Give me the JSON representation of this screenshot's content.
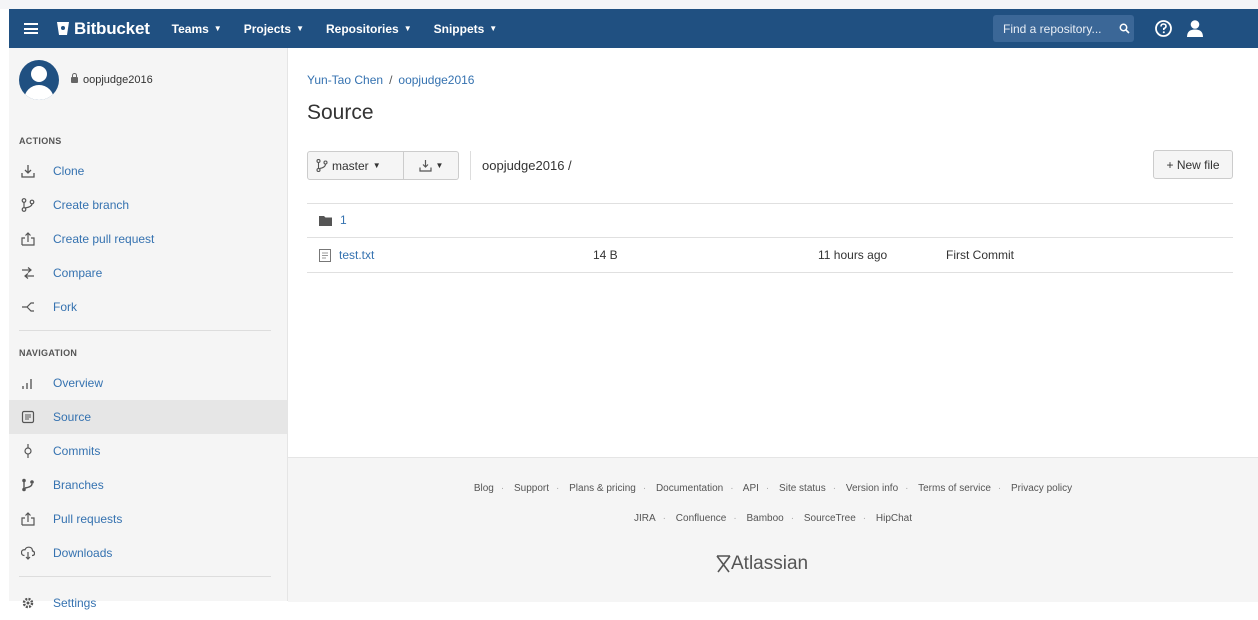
{
  "header": {
    "brand": "Bitbucket",
    "nav": [
      {
        "label": "Teams"
      },
      {
        "label": "Projects"
      },
      {
        "label": "Repositories"
      },
      {
        "label": "Snippets"
      }
    ],
    "search_placeholder": "Find a repository...",
    "icons": [
      "menu-icon",
      "bitbucket-logo-icon",
      "search-icon",
      "help-icon",
      "user-icon"
    ],
    "bg_color": "#205081"
  },
  "sidebar": {
    "repo_name": "oopjudge2016",
    "actions_title": "ACTIONS",
    "actions": [
      {
        "label": "Clone",
        "icon": "clone-icon"
      },
      {
        "label": "Create branch",
        "icon": "branch-icon"
      },
      {
        "label": "Create pull request",
        "icon": "pull-request-icon"
      },
      {
        "label": "Compare",
        "icon": "compare-icon"
      },
      {
        "label": "Fork",
        "icon": "fork-icon"
      }
    ],
    "navigation_title": "NAVIGATION",
    "navigation": [
      {
        "label": "Overview",
        "icon": "overview-icon"
      },
      {
        "label": "Source",
        "icon": "source-icon",
        "active": true
      },
      {
        "label": "Commits",
        "icon": "commits-icon"
      },
      {
        "label": "Branches",
        "icon": "branches-icon"
      },
      {
        "label": "Pull requests",
        "icon": "pull-requests-icon"
      },
      {
        "label": "Downloads",
        "icon": "downloads-icon"
      },
      {
        "label": "Settings",
        "icon": "settings-icon"
      }
    ]
  },
  "main": {
    "breadcrumb": {
      "owner": "Yun-Tao Chen",
      "separator": "/",
      "repo": "oopjudge2016"
    },
    "title": "Source",
    "branch": "master",
    "path": "oopjudge2016 /",
    "new_file": "+ New file",
    "files": [
      {
        "type": "folder",
        "name": "1",
        "size": "",
        "time": "",
        "message": ""
      },
      {
        "type": "file",
        "name": "test.txt",
        "size": "14 B",
        "time": "11 hours ago",
        "message": "First Commit"
      }
    ]
  },
  "footer": {
    "links_row1": [
      "Blog",
      "Support",
      "Plans & pricing",
      "Documentation",
      "API",
      "Site status",
      "Version info",
      "Terms of service",
      "Privacy policy"
    ],
    "links_row2": [
      "JIRA",
      "Confluence",
      "Bamboo",
      "SourceTree",
      "HipChat"
    ],
    "brand": "Atlassian"
  }
}
